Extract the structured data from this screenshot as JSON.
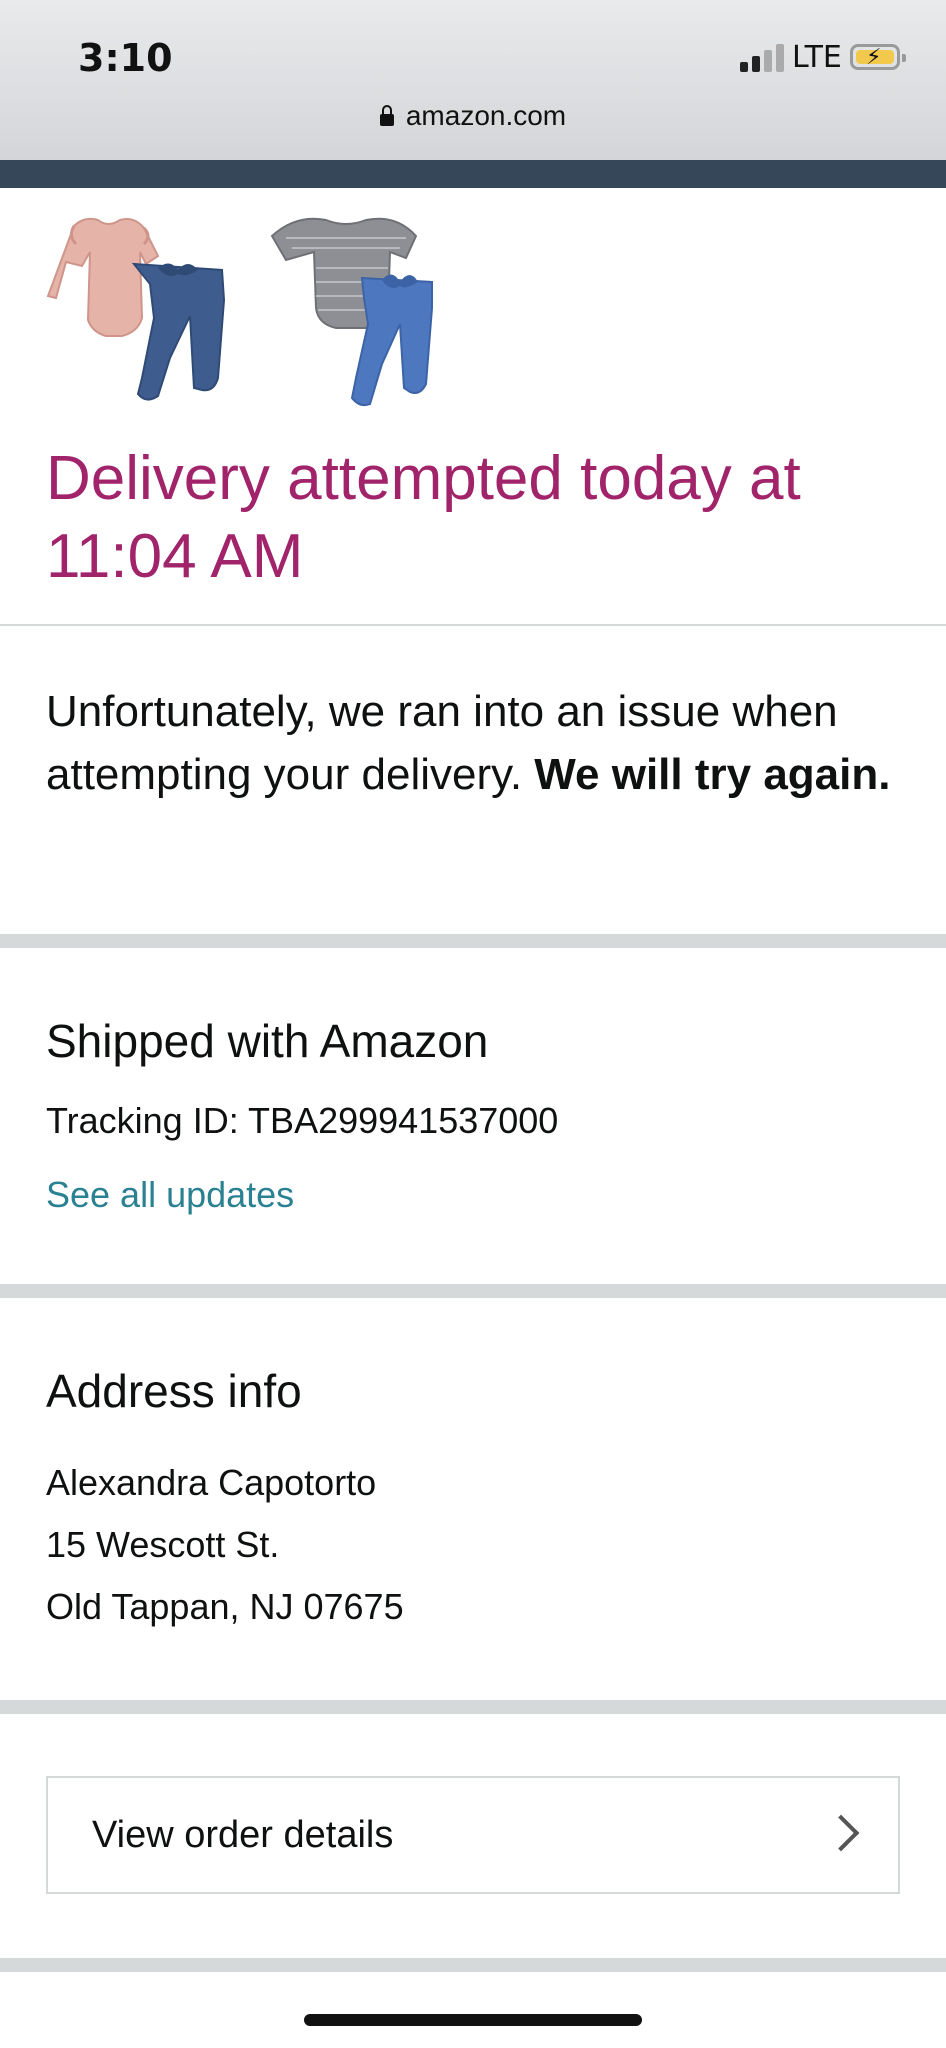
{
  "status_bar": {
    "time": "3:10",
    "network": "LTE",
    "icons": [
      "cellular-signal-icon",
      "battery-charging-icon"
    ]
  },
  "browser": {
    "url": "amazon.com",
    "icons": [
      "lock-icon"
    ]
  },
  "products": [
    {
      "name": "pink-ruffle-romper-with-denim-pants"
    },
    {
      "name": "gray-striped-romper-with-blue-pants"
    }
  ],
  "delivery": {
    "headline": "Delivery attempted today at 11:04 AM",
    "message_plain": "Unfortunately, we ran into an issue when attempting your delivery. ",
    "message_bold": "We will try again."
  },
  "shipping": {
    "title": "Shipped with Amazon",
    "tracking": "Tracking ID: TBA299941537000",
    "updates_link": "See all updates"
  },
  "address": {
    "title": "Address info",
    "name": "Alexandra Capotorto",
    "street": "15 Wescott St.",
    "city": "Old Tappan, NJ 07675"
  },
  "order": {
    "button_label": "View order details",
    "icons": [
      "chevron-right-icon"
    ]
  },
  "colors": {
    "headline": "#a1246b",
    "link": "#2a8191",
    "nav_strip": "#37475a",
    "divider": "#d5d9d9"
  }
}
